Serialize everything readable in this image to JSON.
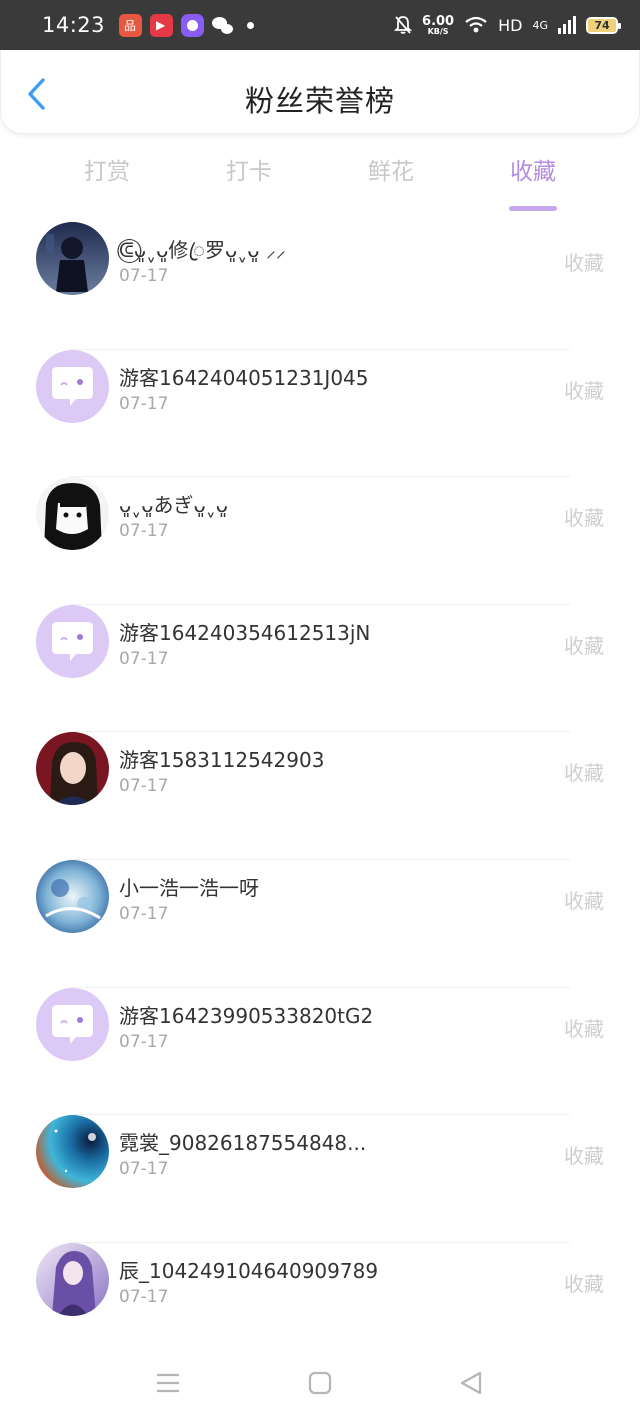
{
  "status_bar": {
    "time": "14:23",
    "speed_value": "6.00",
    "speed_unit": "KB/S",
    "hd": "HD",
    "network": "4G",
    "battery": "74"
  },
  "header": {
    "title": "粉丝荣誉榜",
    "back_icon": "chevron-left-icon"
  },
  "tabs": [
    {
      "label": "打赏",
      "active": false
    },
    {
      "label": "打卡",
      "active": false
    },
    {
      "label": "鲜花",
      "active": false
    },
    {
      "label": "收藏",
      "active": true
    }
  ],
  "colors": {
    "accent": "#b58de0",
    "indicator": "#c6a6ec",
    "back_icon": "#3d9df3",
    "default_avatar_bg": "#dcc9f6"
  },
  "fans": [
    {
      "name": "ᕳ⃝ᴗ͈ˬᴗ͈修ꦿ罗ᴗ͈ˬᴗ͈ ⸝⸝",
      "date": "07-17",
      "action": "收藏",
      "avatar": "dark-anime-avatar"
    },
    {
      "name": "游客1642404051231J045",
      "date": "07-17",
      "action": "收藏",
      "avatar": "default-chat-avatar"
    },
    {
      "name": "ᴗ͈ˬᴗ͈あぎᴗ͈ˬᴗ͈",
      "date": "07-17",
      "action": "收藏",
      "avatar": "black-hair-anime-avatar"
    },
    {
      "name": "游客164240354612513jN",
      "date": "07-17",
      "action": "收藏",
      "avatar": "default-chat-avatar"
    },
    {
      "name": "游客1583112542903",
      "date": "07-17",
      "action": "收藏",
      "avatar": "girl-photo-avatar"
    },
    {
      "name": "小一浩一浩一呀",
      "date": "07-17",
      "action": "收藏",
      "avatar": "blue-anime-avatar"
    },
    {
      "name": "游客16423990533820tG2",
      "date": "07-17",
      "action": "收藏",
      "avatar": "default-chat-avatar"
    },
    {
      "name": "霓裳_90826187554848...",
      "date": "07-17",
      "action": "收藏",
      "avatar": "galaxy-avatar"
    },
    {
      "name": "辰_104249104640909789",
      "date": "07-17",
      "action": "收藏",
      "avatar": "purple-anime-avatar"
    }
  ],
  "nav_bar": [
    "menu-icon",
    "home-square-icon",
    "back-triangle-icon"
  ]
}
